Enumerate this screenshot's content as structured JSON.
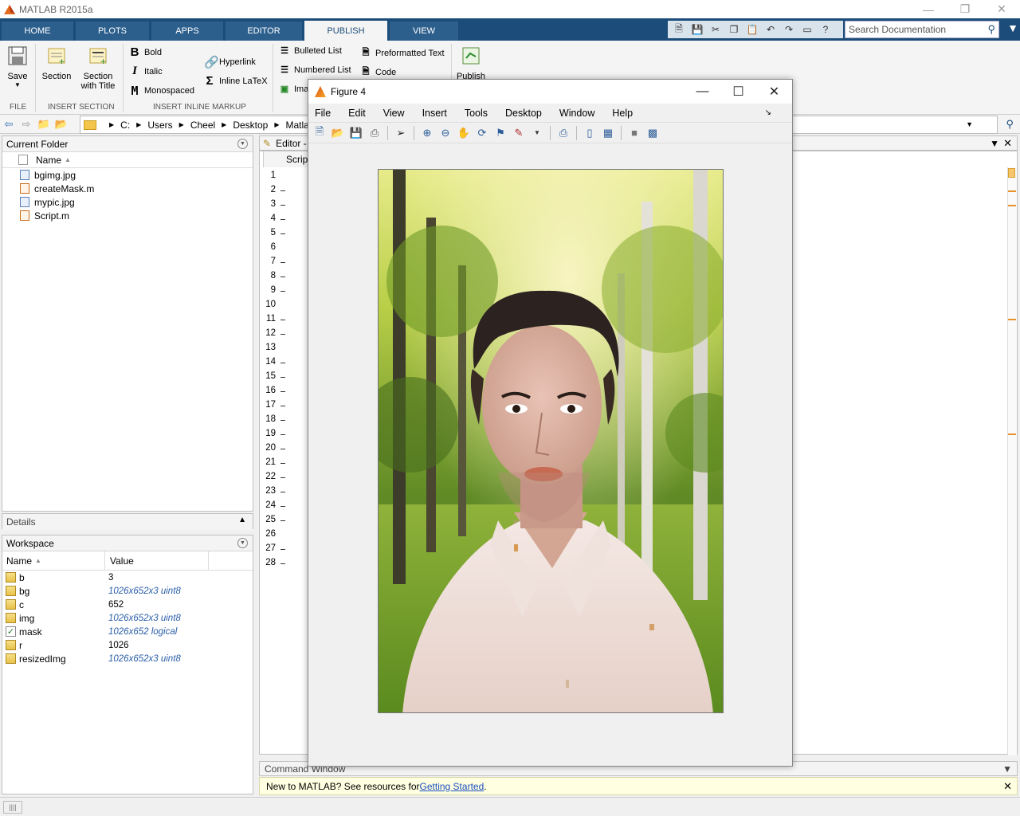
{
  "window": {
    "title": "MATLAB R2015a"
  },
  "ribbon_tabs": [
    "HOME",
    "PLOTS",
    "APPS",
    "EDITOR",
    "PUBLISH",
    "VIEW"
  ],
  "search": {
    "placeholder": "Search Documentation"
  },
  "ribbon": {
    "save": "Save",
    "section": "Section",
    "section_title_1": "Section",
    "section_title_2": "with Title",
    "bold": "Bold",
    "italic": "Italic",
    "monospaced": "Monospaced",
    "hyperlink": "Hyperlink",
    "inline_latex": "Inline LaTeX",
    "bulleted": "Bulleted List",
    "numbered": "Numbered List",
    "image": "Ima",
    "preformatted": "Preformatted Text",
    "code": "Code",
    "publish": "Publish",
    "labels": {
      "file": "FILE",
      "insert_section": "INSERT SECTION",
      "insert_inline": "INSERT INLINE MARKUP"
    }
  },
  "path": [
    "C:",
    "Users",
    "Cheel",
    "Desktop",
    "Matlab Pr"
  ],
  "current_folder": {
    "title": "Current Folder",
    "col_name": "Name",
    "files": [
      {
        "name": "bgimg.jpg",
        "type": "img"
      },
      {
        "name": "createMask.m",
        "type": "m"
      },
      {
        "name": "mypic.jpg",
        "type": "img"
      },
      {
        "name": "Script.m",
        "type": "m"
      }
    ]
  },
  "details": {
    "title": "Details"
  },
  "workspace": {
    "title": "Workspace",
    "col_name": "Name",
    "col_value": "Value",
    "vars": [
      {
        "name": "b",
        "value": "3",
        "italic": false,
        "logical": false
      },
      {
        "name": "bg",
        "value": "1026x652x3 uint8",
        "italic": true,
        "logical": false
      },
      {
        "name": "c",
        "value": "652",
        "italic": false,
        "logical": false
      },
      {
        "name": "img",
        "value": "1026x652x3 uint8",
        "italic": true,
        "logical": false
      },
      {
        "name": "mask",
        "value": "1026x652 logical",
        "italic": true,
        "logical": true
      },
      {
        "name": "r",
        "value": "1026",
        "italic": false,
        "logical": false
      },
      {
        "name": "resizedImg",
        "value": "1026x652x3 uint8",
        "italic": true,
        "logical": false
      }
    ]
  },
  "editor": {
    "title": "Editor -",
    "tab": "Script",
    "line_numbers": [
      "1",
      "2",
      "3",
      "4",
      "5",
      "6",
      "7",
      "8",
      "9",
      "10",
      "11",
      "12",
      "13",
      "14",
      "15",
      "16",
      "17",
      "18",
      "19",
      "20",
      "21",
      "22",
      "23",
      "24",
      "25",
      "26",
      "27",
      "28"
    ]
  },
  "command_window": {
    "title": "Command Window",
    "message": "New to MATLAB? See resources for ",
    "link": "Getting Started",
    "period": "."
  },
  "figure": {
    "title": "Figure 4",
    "menu": [
      "File",
      "Edit",
      "View",
      "Insert",
      "Tools",
      "Desktop",
      "Window",
      "Help"
    ]
  }
}
